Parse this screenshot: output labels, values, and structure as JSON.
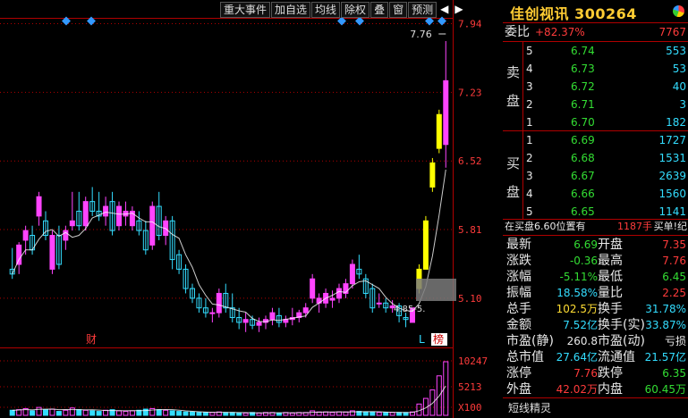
{
  "toolbar": {
    "buttons": [
      "重大事件",
      "加自选",
      "均线",
      "除权",
      "叠",
      "窗",
      "预测"
    ],
    "nav_prev": "◀",
    "nav_next": "▶"
  },
  "chart": {
    "price_ticks": [
      "7.94",
      "7.23",
      "6.52",
      "5.81",
      "5.10"
    ],
    "volume_ticks": [
      "10247",
      "5213",
      "X100"
    ],
    "high_label": "7.76",
    "low_label": "4.85",
    "marker_cai": "财",
    "marker_l": "L",
    "marker_bang": "榜",
    "colors": {
      "up": "#ff44ff",
      "down": "#33ddff",
      "limit": "#ffff00",
      "grid": "#b00000",
      "ma": "#ffffff"
    }
  },
  "chart_data": {
    "type": "candlestick",
    "ylim": [
      4.6,
      8.0
    ],
    "candles": [
      {
        "o": 5.4,
        "h": 5.62,
        "l": 5.3,
        "c": 5.35
      },
      {
        "o": 5.45,
        "h": 5.68,
        "l": 5.35,
        "c": 5.65
      },
      {
        "o": 5.7,
        "h": 5.85,
        "l": 5.55,
        "c": 5.8
      },
      {
        "o": 5.75,
        "h": 5.85,
        "l": 5.55,
        "c": 5.6
      },
      {
        "o": 5.95,
        "h": 6.2,
        "l": 5.85,
        "c": 6.15
      },
      {
        "o": 5.9,
        "h": 6.0,
        "l": 5.7,
        "c": 5.75
      },
      {
        "o": 5.4,
        "h": 5.8,
        "l": 5.35,
        "c": 5.75
      },
      {
        "o": 5.75,
        "h": 5.85,
        "l": 5.4,
        "c": 5.45
      },
      {
        "o": 5.7,
        "h": 5.85,
        "l": 5.6,
        "c": 5.8
      },
      {
        "o": 5.85,
        "h": 6.2,
        "l": 5.8,
        "c": 5.9
      },
      {
        "o": 6.0,
        "h": 6.2,
        "l": 5.8,
        "c": 5.85
      },
      {
        "o": 5.85,
        "h": 6.15,
        "l": 5.8,
        "c": 6.1
      },
      {
        "o": 6.1,
        "h": 6.25,
        "l": 5.95,
        "c": 6.0
      },
      {
        "o": 6.0,
        "h": 6.2,
        "l": 5.9,
        "c": 5.95
      },
      {
        "o": 5.95,
        "h": 6.15,
        "l": 5.85,
        "c": 6.05
      },
      {
        "o": 6.1,
        "h": 6.2,
        "l": 5.75,
        "c": 5.8
      },
      {
        "o": 5.85,
        "h": 6.1,
        "l": 5.8,
        "c": 6.05
      },
      {
        "o": 5.95,
        "h": 6.1,
        "l": 5.85,
        "c": 6.0
      },
      {
        "o": 5.85,
        "h": 6.05,
        "l": 5.8,
        "c": 6.0
      },
      {
        "o": 5.9,
        "h": 6.0,
        "l": 5.75,
        "c": 5.8
      },
      {
        "o": 5.8,
        "h": 5.9,
        "l": 5.55,
        "c": 5.6
      },
      {
        "o": 5.65,
        "h": 6.1,
        "l": 5.6,
        "c": 6.05
      },
      {
        "o": 6.05,
        "h": 6.2,
        "l": 5.7,
        "c": 5.75
      },
      {
        "o": 5.75,
        "h": 5.95,
        "l": 5.65,
        "c": 5.9
      },
      {
        "o": 5.9,
        "h": 5.95,
        "l": 5.4,
        "c": 5.5
      },
      {
        "o": 5.55,
        "h": 5.6,
        "l": 5.35,
        "c": 5.4
      },
      {
        "o": 5.4,
        "h": 5.45,
        "l": 5.15,
        "c": 5.2
      },
      {
        "o": 5.2,
        "h": 5.25,
        "l": 5.05,
        "c": 5.1
      },
      {
        "o": 5.1,
        "h": 5.15,
        "l": 4.95,
        "c": 5.0
      },
      {
        "o": 5.0,
        "h": 5.1,
        "l": 4.9,
        "c": 4.95
      },
      {
        "o": 4.95,
        "h": 5.0,
        "l": 4.85,
        "c": 4.95
      },
      {
        "o": 4.95,
        "h": 5.2,
        "l": 4.9,
        "c": 5.15
      },
      {
        "o": 5.15,
        "h": 5.25,
        "l": 4.95,
        "c": 5.0
      },
      {
        "o": 5.0,
        "h": 5.15,
        "l": 4.85,
        "c": 4.9
      },
      {
        "o": 4.9,
        "h": 5.0,
        "l": 4.78,
        "c": 4.85
      },
      {
        "o": 4.85,
        "h": 4.95,
        "l": 4.75,
        "c": 4.88
      },
      {
        "o": 4.88,
        "h": 4.92,
        "l": 4.78,
        "c": 4.82
      },
      {
        "o": 4.82,
        "h": 4.9,
        "l": 4.75,
        "c": 4.85
      },
      {
        "o": 4.85,
        "h": 4.92,
        "l": 4.78,
        "c": 4.88
      },
      {
        "o": 4.88,
        "h": 5.0,
        "l": 4.82,
        "c": 4.95
      },
      {
        "o": 4.92,
        "h": 5.0,
        "l": 4.8,
        "c": 4.85
      },
      {
        "o": 4.85,
        "h": 4.92,
        "l": 4.8,
        "c": 4.88
      },
      {
        "o": 4.88,
        "h": 5.0,
        "l": 4.82,
        "c": 4.9
      },
      {
        "o": 4.9,
        "h": 4.98,
        "l": 4.85,
        "c": 4.95
      },
      {
        "o": 4.95,
        "h": 5.05,
        "l": 4.9,
        "c": 5.0
      },
      {
        "o": 5.1,
        "h": 5.35,
        "l": 5.05,
        "c": 5.3
      },
      {
        "o": 5.05,
        "h": 5.15,
        "l": 4.95,
        "c": 5.1
      },
      {
        "o": 5.05,
        "h": 5.2,
        "l": 5.0,
        "c": 5.15
      },
      {
        "o": 5.08,
        "h": 5.18,
        "l": 5.0,
        "c": 5.1
      },
      {
        "o": 5.1,
        "h": 5.25,
        "l": 5.05,
        "c": 5.2
      },
      {
        "o": 5.15,
        "h": 5.3,
        "l": 5.1,
        "c": 5.25
      },
      {
        "o": 5.25,
        "h": 5.5,
        "l": 5.2,
        "c": 5.45
      },
      {
        "o": 5.4,
        "h": 5.55,
        "l": 5.3,
        "c": 5.35
      },
      {
        "o": 5.3,
        "h": 5.35,
        "l": 5.1,
        "c": 5.15
      },
      {
        "o": 5.2,
        "h": 5.25,
        "l": 4.95,
        "c": 5.0
      },
      {
        "o": 5.05,
        "h": 5.15,
        "l": 5.0,
        "c": 5.05
      },
      {
        "o": 5.05,
        "h": 5.1,
        "l": 4.95,
        "c": 5.0
      },
      {
        "o": 5.0,
        "h": 5.08,
        "l": 4.95,
        "c": 5.02
      },
      {
        "o": 5.02,
        "h": 5.05,
        "l": 4.85,
        "c": 4.92
      },
      {
        "o": 4.9,
        "h": 4.95,
        "l": 4.8,
        "c": 4.88
      },
      {
        "o": 4.85,
        "h": 5.0,
        "l": 4.85,
        "c": 5.0
      },
      {
        "o": 5.2,
        "h": 5.45,
        "l": 5.15,
        "c": 5.4
      },
      {
        "o": 5.4,
        "h": 5.95,
        "l": 5.4,
        "c": 5.9
      },
      {
        "o": 6.25,
        "h": 6.55,
        "l": 6.2,
        "c": 6.5
      },
      {
        "o": 6.65,
        "h": 7.05,
        "l": 6.6,
        "c": 7.0
      },
      {
        "o": 6.69,
        "h": 7.76,
        "l": 6.45,
        "c": 7.35
      }
    ],
    "volume": [
      9,
      10,
      12,
      8,
      14,
      10,
      11,
      7,
      9,
      13,
      10,
      9,
      8,
      7,
      9,
      10,
      8,
      7,
      8,
      9,
      11,
      12,
      10,
      9,
      8,
      7,
      6,
      6,
      5,
      5,
      5,
      6,
      5,
      5,
      4,
      4,
      5,
      4,
      5,
      5,
      4,
      5,
      4,
      5,
      5,
      8,
      6,
      6,
      5,
      6,
      6,
      8,
      7,
      6,
      6,
      5,
      5,
      5,
      5,
      5,
      6,
      20,
      30,
      45,
      70,
      95
    ]
  },
  "panel": {
    "stock_name": "佳创视讯",
    "stock_code": "300264",
    "weibi_label": "委比",
    "weibi_pct": "+82.37%",
    "weibi_val": "7767",
    "sell_label": [
      "卖",
      "盘"
    ],
    "buy_label": [
      "买",
      "盘"
    ],
    "sell": [
      {
        "lvl": "5",
        "price": "6.74",
        "vol": "553"
      },
      {
        "lvl": "4",
        "price": "6.73",
        "vol": "53"
      },
      {
        "lvl": "3",
        "price": "6.72",
        "vol": "40"
      },
      {
        "lvl": "2",
        "price": "6.71",
        "vol": "3"
      },
      {
        "lvl": "1",
        "price": "6.70",
        "vol": "182"
      }
    ],
    "buy": [
      {
        "lvl": "1",
        "price": "6.69",
        "vol": "1727"
      },
      {
        "lvl": "2",
        "price": "6.68",
        "vol": "1531"
      },
      {
        "lvl": "3",
        "price": "6.67",
        "vol": "2639"
      },
      {
        "lvl": "4",
        "price": "6.66",
        "vol": "1560"
      },
      {
        "lvl": "5",
        "price": "6.65",
        "vol": "1141"
      }
    ],
    "notice": "在买盘6.60位置有",
    "notice_vol": "1187手",
    "notice_tail": "买单!纪",
    "stats": [
      {
        "l1": "最新",
        "v1": "6.69",
        "c1": "green",
        "l2": "开盘",
        "v2": "7.35",
        "c2": "red"
      },
      {
        "l1": "涨跌",
        "v1": "-0.36",
        "c1": "green",
        "l2": "最高",
        "v2": "7.76",
        "c2": "red"
      },
      {
        "l1": "涨幅",
        "v1": "-5.11%",
        "c1": "green",
        "l2": "最低",
        "v2": "6.45",
        "c2": "green"
      },
      {
        "l1": "振幅",
        "v1": "18.58%",
        "c1": "cyan",
        "l2": "量比",
        "v2": "2.25",
        "c2": "red"
      },
      {
        "l1": "总手",
        "v1": "102.5万",
        "c1": "yellow",
        "l2": "换手",
        "v2": "31.78%",
        "c2": "cyan"
      },
      {
        "l1": "金额",
        "v1": "7.52亿",
        "c1": "cyan",
        "l2": "换手(实)",
        "v2": "33.87%",
        "c2": "cyan"
      },
      {
        "l1": "市盈(静)",
        "v1": "260.8",
        "c1": "white",
        "l2": "市盈(动)",
        "v2": "亏损",
        "c2": "white"
      },
      {
        "l1": "总市值",
        "v1": "27.64亿",
        "c1": "cyan",
        "l2": "流通值",
        "v2": "21.57亿",
        "c2": "cyan"
      },
      {
        "l1": "涨停",
        "v1": "7.76",
        "c1": "red",
        "l2": "跌停",
        "v2": "6.35",
        "c2": "green"
      },
      {
        "l1": "外盘",
        "v1": "42.02万",
        "c1": "red",
        "l2": "内盘",
        "v2": "60.45万",
        "c2": "green"
      }
    ],
    "footer_tab": "短线精灵"
  }
}
